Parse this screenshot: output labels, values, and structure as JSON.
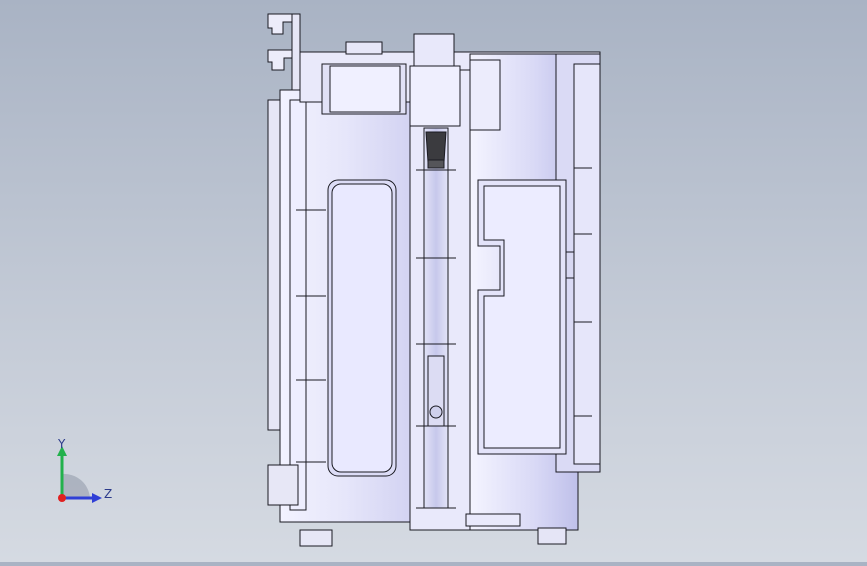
{
  "view": {
    "type": "cad-3d-viewport",
    "model": "cartridge-assembly-side-view",
    "colors": {
      "background_top": "#a9b3c4",
      "background_bottom": "#d5dae2",
      "body_fill": "#ebebfb",
      "body_shade": "#c9c9ee",
      "edge": "#1a1a22",
      "inner_tube": "#cfd0ec",
      "dark_nozzle": "#3b3b3f"
    }
  },
  "triad": {
    "y_label": "Y",
    "z_label": "Z",
    "icon": "coordinate-triad-icon",
    "y_color": "#22b14c",
    "z_color": "#2f3fd6",
    "x_color": "#e02020"
  }
}
